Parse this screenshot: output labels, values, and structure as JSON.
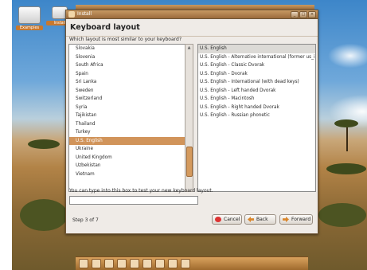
{
  "desktop": {
    "icons": [
      {
        "label": "Examples",
        "icon": "folder-icon"
      },
      {
        "label": "Install",
        "icon": "installer-icon"
      }
    ]
  },
  "window": {
    "title": "Install",
    "buttons": {
      "minimize": "_",
      "maximize": "□",
      "close": "×"
    }
  },
  "page": {
    "heading": "Keyboard layout",
    "question": "Which layout is most similar to your keyboard?",
    "layouts": [
      "Slovakia",
      "Slovenia",
      "South Africa",
      "Spain",
      "Sri Lanka",
      "Sweden",
      "Switzerland",
      "Syria",
      "Tajikistan",
      "Thailand",
      "Turkey",
      "U.S. English",
      "Ukraine",
      "United Kingdom",
      "Uzbekistan",
      "Vietnam"
    ],
    "selected_layout": "U.S. English",
    "variants": [
      "U.S. English",
      "U.S. English - Alternative international (former us_in",
      "U.S. English - Classic Dvorak",
      "U.S. English - Dvorak",
      "U.S. English - International (with dead keys)",
      "U.S. English - Left handed Dvorak",
      "U.S. English - Macintosh",
      "U.S. English - Right handed Dvorak",
      "U.S. English - Russian phonetic"
    ],
    "selected_variant": "U.S. English",
    "test_label": "You can type into this box to test your new keyboard layout.",
    "test_value": "",
    "step": "Step 3 of 7",
    "cancel": "Cancel",
    "back": "Back",
    "forward": "Forward"
  },
  "colors": {
    "accent": "#d1945a",
    "title_bar": "#b07c48"
  }
}
